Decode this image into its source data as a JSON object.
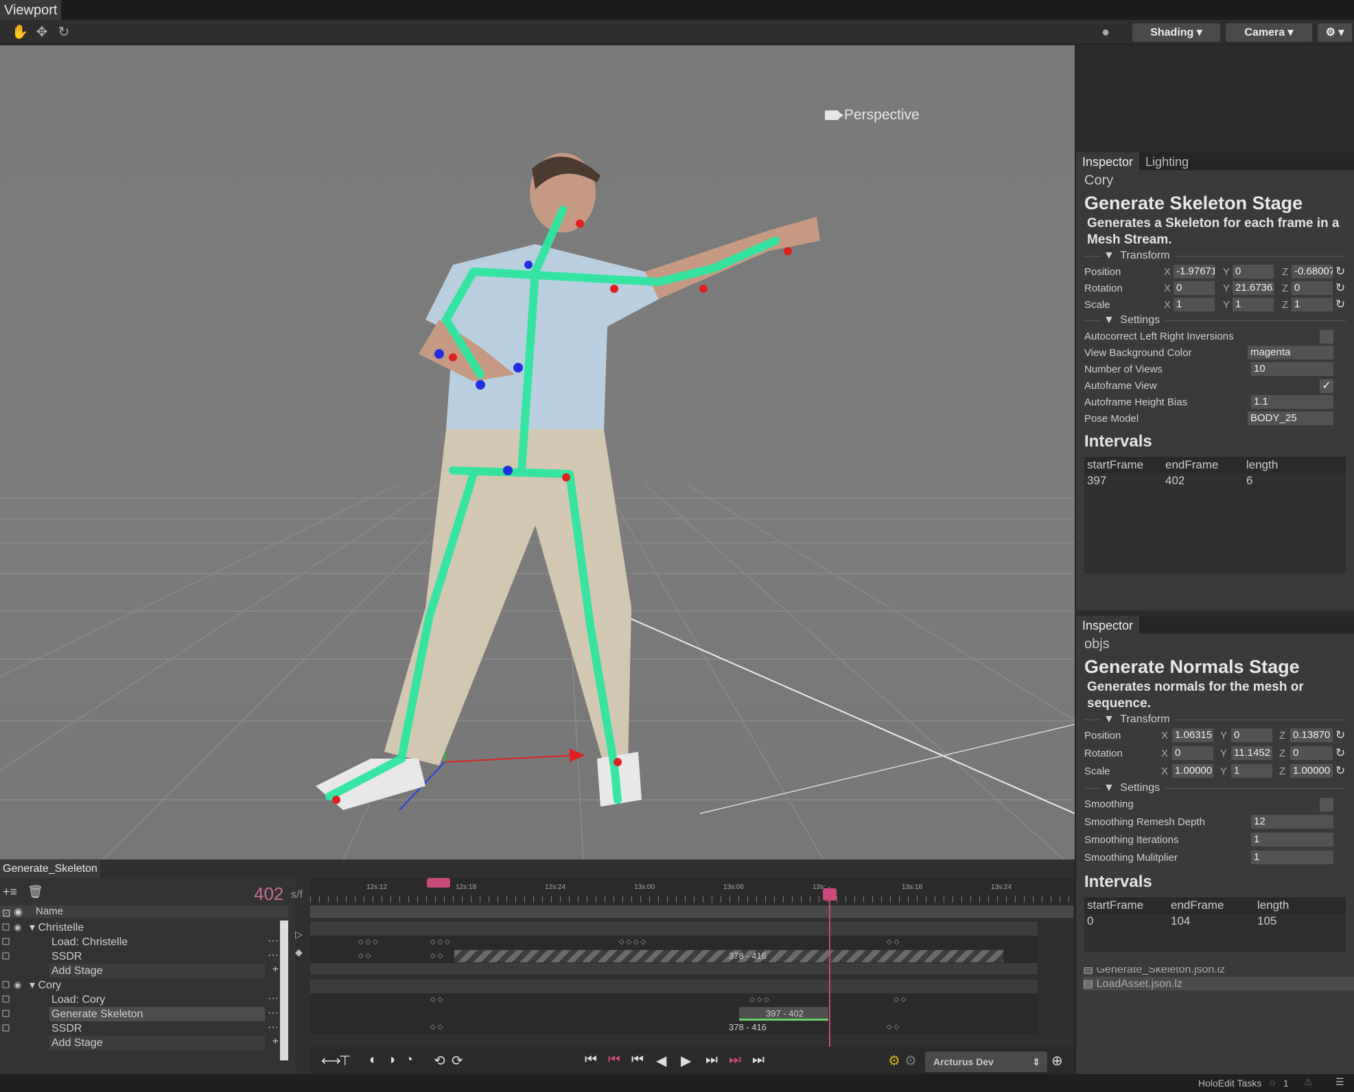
{
  "window": {
    "tab": "Viewport"
  },
  "toolbar": {
    "shading_label": "Shading",
    "camera_label": "Camera"
  },
  "viewport": {
    "camera_mode": "Perspective"
  },
  "inspector_top": {
    "tabs": [
      "Inspector",
      "Lighting"
    ],
    "object_name": "Cory",
    "stage_title": "Generate Skeleton Stage",
    "stage_desc_1": "Generates a Skeleton for each frame in a",
    "stage_desc_2": "Mesh Stream.",
    "transform_label": "Transform",
    "position": {
      "label": "Position",
      "x": "-1.97671",
      "y": "0",
      "z": "-0.68007"
    },
    "rotation": {
      "label": "Rotation",
      "x": "0",
      "y": "21.67363",
      "z": "0"
    },
    "scale": {
      "label": "Scale",
      "x": "1",
      "y": "1",
      "z": "1"
    },
    "settings_label": "Settings",
    "settings": [
      {
        "label": "Autocorrect Left Right Inversions",
        "value": ""
      },
      {
        "label": "View Background Color",
        "value": "magenta"
      },
      {
        "label": "Number of Views",
        "value": "10"
      },
      {
        "label": "Autoframe View",
        "value": "✓"
      },
      {
        "label": "Autoframe Height Bias",
        "value": "1.1"
      },
      {
        "label": "Pose Model",
        "value": "BODY_25"
      }
    ],
    "intervals_label": "Intervals",
    "intervals_headers": [
      "startFrame",
      "endFrame",
      "length"
    ],
    "intervals_row": [
      "397",
      "402",
      "6"
    ]
  },
  "inspector_bottom": {
    "tab": "Inspector",
    "object_name": "objs",
    "stage_title": "Generate Normals Stage",
    "stage_desc_1": "Generates normals for the mesh or",
    "stage_desc_2": "sequence.",
    "transform_label": "Transform",
    "position": {
      "label": "Position",
      "x": "1.06315",
      "y": "0",
      "z": "0.13870"
    },
    "rotation": {
      "label": "Rotation",
      "x": "0",
      "y": "11.1452",
      "z": "0"
    },
    "scale": {
      "label": "Scale",
      "x": "1.00000",
      "y": "1",
      "z": "1.00000"
    },
    "settings_label": "Settings",
    "settings": [
      {
        "label": "Smoothing",
        "value": ""
      },
      {
        "label": "Smoothing Remesh Depth",
        "value": "12"
      },
      {
        "label": "Smoothing Iterations",
        "value": "1"
      },
      {
        "label": "Smoothing Mulitplier",
        "value": "1"
      }
    ],
    "intervals_label": "Intervals",
    "intervals_headers": [
      "startFrame",
      "endFrame",
      "length"
    ],
    "intervals_row": [
      "0",
      "104",
      "105"
    ],
    "files": [
      "Generate_Skeleton.json.lz",
      "LoadAsset.json.lz"
    ]
  },
  "timeline": {
    "tab": "Generate_Skeleton",
    "frame": "402",
    "frame_unit": "s/f",
    "name_header": "Name",
    "ticks": [
      "12s:12",
      "12s:18",
      "12s:24",
      "13s:00",
      "13s:06",
      "13s:",
      "13s:18",
      "13s:24"
    ],
    "tree": [
      {
        "label": "Christelle",
        "kind": "group"
      },
      {
        "label": "Load: Christelle",
        "kind": "stage"
      },
      {
        "label": "SSDR",
        "kind": "stage"
      },
      {
        "label": "Add Stage",
        "kind": "add"
      },
      {
        "label": "Cory",
        "kind": "group"
      },
      {
        "label": "Load: Cory",
        "kind": "stage"
      },
      {
        "label": "Generate Skeleton",
        "kind": "stage"
      },
      {
        "label": "SSDR",
        "kind": "stage"
      },
      {
        "label": "Add Stage",
        "kind": "add"
      }
    ],
    "clip_christelle_ssdr": "378 - 416",
    "clip_cory_skeleton": "397 - 402",
    "clip_cory_ssdr": "378 - 416",
    "profile": "Arcturus Dev"
  },
  "status": {
    "tasks_label": "HoloEdit Tasks",
    "task_count": "1"
  }
}
